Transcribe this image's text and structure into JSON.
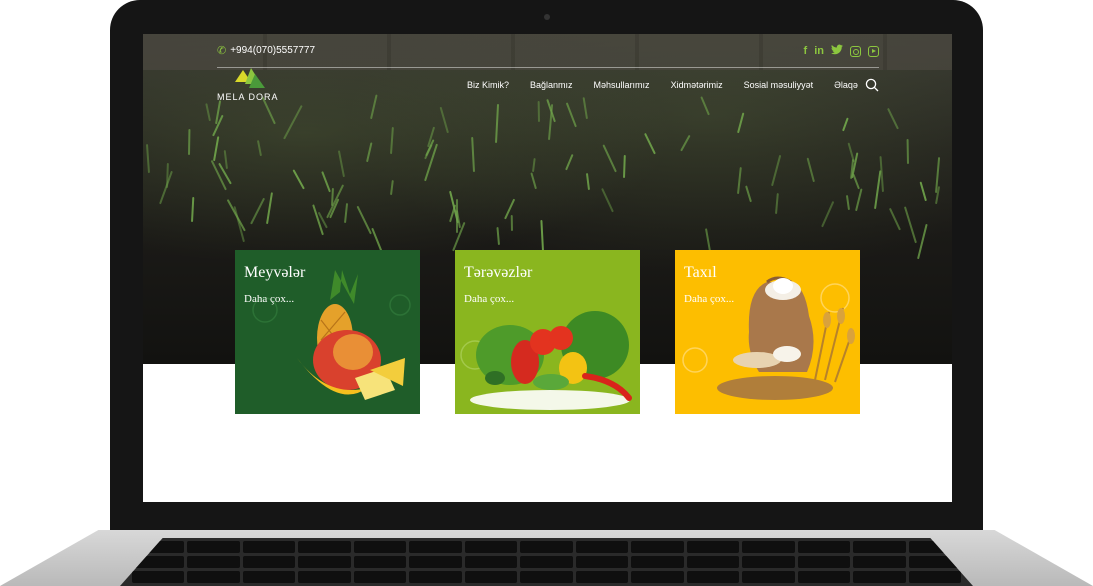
{
  "site": {
    "phone": "+994(070)5557777",
    "logo_text": "MELA DORA",
    "social_icons": [
      "facebook-icon",
      "linkedin-icon",
      "twitter-icon",
      "instagram-icon",
      "youtube-icon"
    ],
    "accent_color": "#8cc63f"
  },
  "nav": {
    "items": [
      {
        "label": "Biz Kimik?"
      },
      {
        "label": "Bağlanmız"
      },
      {
        "label": "Məhsullarımız"
      },
      {
        "label": "Xidmətərimiz"
      },
      {
        "label": "Sosial məsuliyyət"
      },
      {
        "label": "Əlaqə"
      }
    ]
  },
  "cards": [
    {
      "title": "Meyvələr",
      "more": "Daha çox...",
      "color": "#1f5d29"
    },
    {
      "title": "Tərəvəzlər",
      "more": "Daha çox...",
      "color": "#8ab61f"
    },
    {
      "title": "Taxıl",
      "more": "Daha çox...",
      "color": "#fdbe00"
    }
  ]
}
